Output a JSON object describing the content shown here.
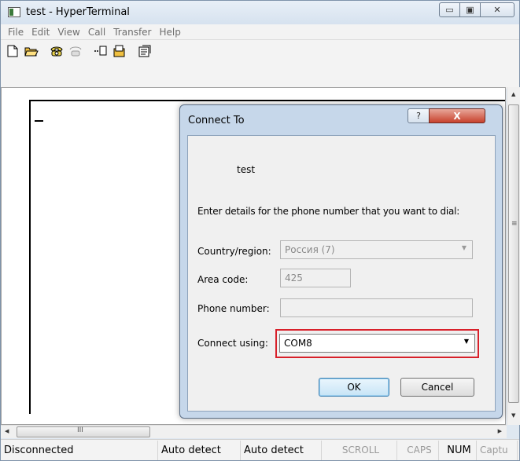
{
  "window": {
    "title": "test - HyperTerminal",
    "caption_buttons": {
      "minimize": "▭",
      "maximize": "▣",
      "close": "✕"
    }
  },
  "menu": [
    "File",
    "Edit",
    "View",
    "Call",
    "Transfer",
    "Help"
  ],
  "toolbar": {
    "icons": [
      "new-icon",
      "open-icon",
      "call-icon",
      "disconnect-icon",
      "send-icon",
      "receive-icon",
      "properties-icon"
    ]
  },
  "terminal": {
    "cursor": "_"
  },
  "scrollbars": {
    "grip": "≡",
    "hgrip": "III"
  },
  "statusbar": {
    "items": [
      "Disconnected",
      "Auto detect",
      "Auto detect",
      "SCROLL",
      "CAPS",
      "NUM",
      "Captu"
    ]
  },
  "dialog": {
    "title": "Connect To",
    "help_label": "?",
    "close_label": "X",
    "entry_name": "test",
    "prompt": "Enter details for the phone number that you want to dial:",
    "country_label": "Country/region:",
    "country_value": "Россия (7)",
    "area_code_label": "Area code:",
    "area_code_value": "425",
    "phone_label": "Phone number:",
    "phone_value": "",
    "connect_label": "Connect using:",
    "connect_value": "COM8",
    "ok_label": "OK",
    "cancel_label": "Cancel",
    "highlight_color": "#d8202a"
  }
}
